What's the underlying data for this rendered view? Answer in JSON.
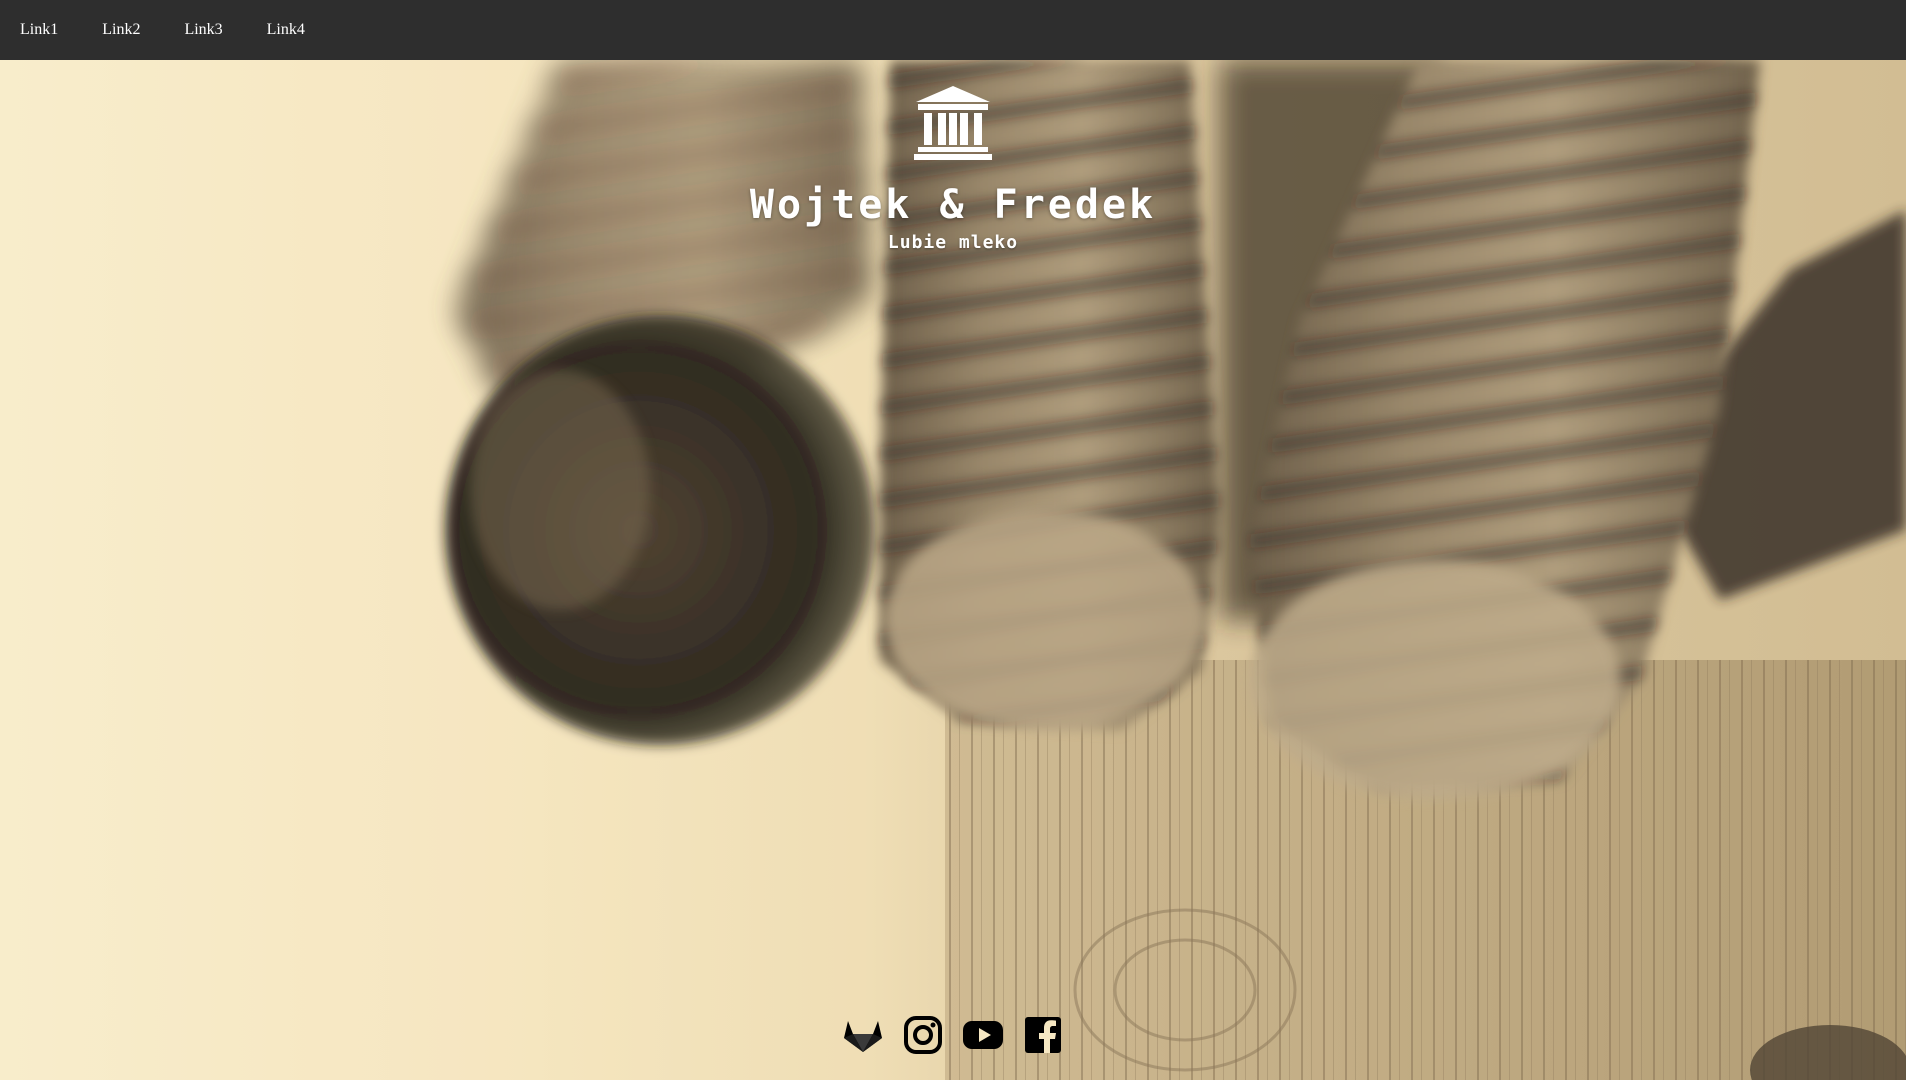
{
  "nav": {
    "links": [
      {
        "label": "Link1"
      },
      {
        "label": "Link2"
      },
      {
        "label": "Link3"
      },
      {
        "label": "Link4"
      }
    ]
  },
  "hero": {
    "title": "Wojtek & Fredek",
    "subtitle": "Lubie mleko",
    "icon": "building-columns-icon"
  },
  "social": {
    "icons": [
      "gitlab-icon",
      "instagram-icon",
      "youtube-icon",
      "facebook-icon"
    ]
  },
  "colors": {
    "navbar": "#2e2e2e",
    "nav_text": "#ffffff",
    "brand_text": "#ffffff",
    "social_icon": "#000000",
    "background_sepia": "#f6e8c3"
  }
}
